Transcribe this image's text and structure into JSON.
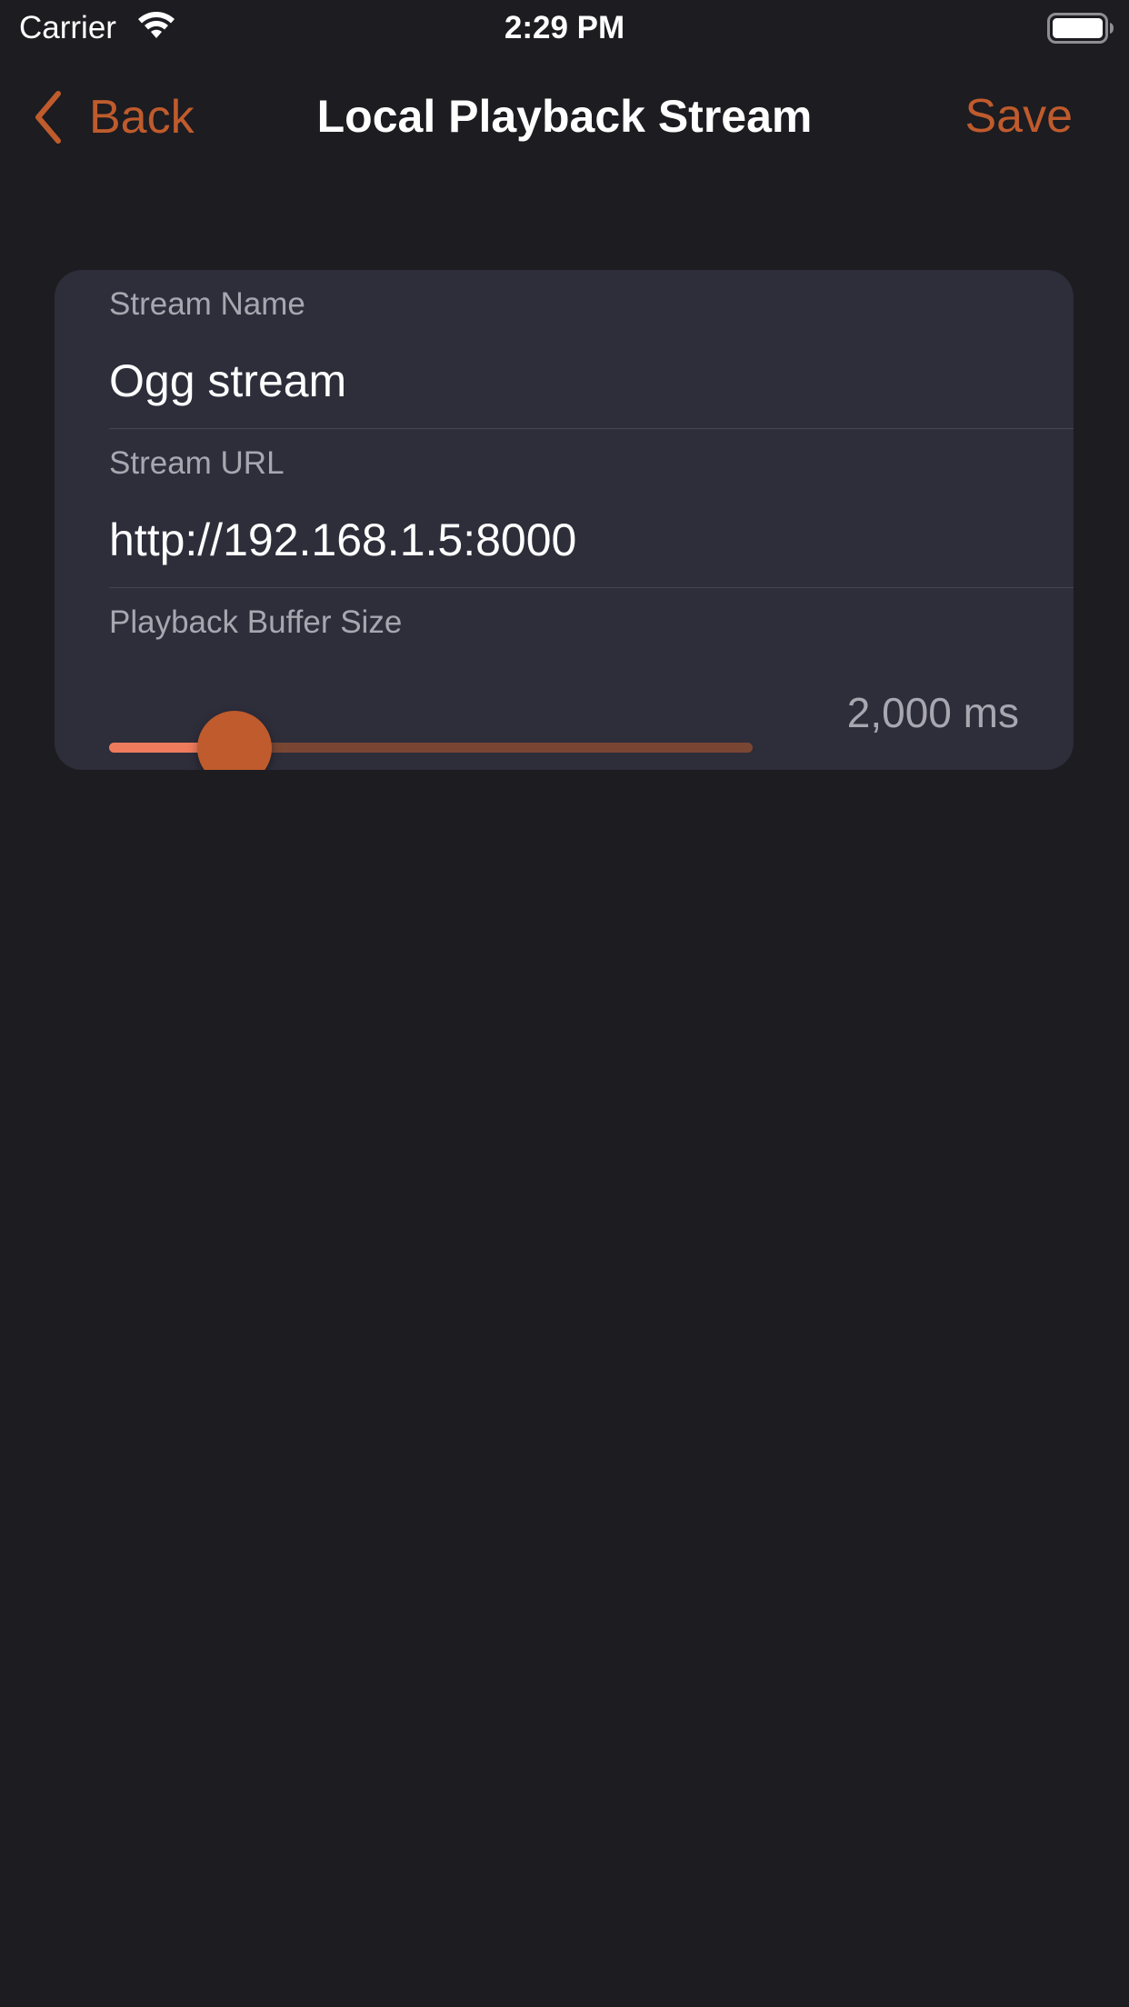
{
  "status_bar": {
    "carrier": "Carrier",
    "time": "2:29 PM",
    "wifi_icon": "wifi-icon",
    "battery_icon": "battery-full-icon"
  },
  "nav": {
    "back_label": "Back",
    "back_icon": "chevron-left-icon",
    "title": "Local Playback Stream",
    "save_label": "Save"
  },
  "form": {
    "stream_name": {
      "label": "Stream Name",
      "value": "Ogg stream"
    },
    "stream_url": {
      "label": "Stream URL",
      "value": "http://192.168.1.5:8000"
    },
    "buffer_size": {
      "label": "Playback Buffer Size",
      "display_value": "2,000 ms",
      "slider_fraction": 0.195
    }
  },
  "colors": {
    "accent": "#bf5b2c",
    "background": "#1c1c21",
    "card": "#2e2d3a",
    "secondary_text": "#a8a7b0",
    "slider_fill": "#ee7b5c",
    "slider_track": "#7a4634"
  }
}
